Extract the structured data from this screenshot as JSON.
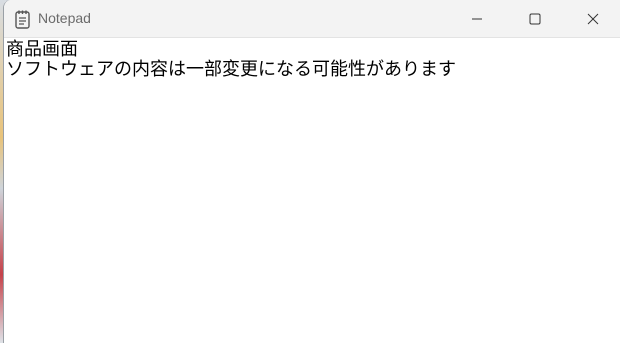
{
  "window": {
    "title": "Notepad",
    "controls": {
      "minimize_icon": "minimize-icon",
      "maximize_icon": "maximize-icon",
      "close_icon": "close-icon"
    }
  },
  "document": {
    "lines": [
      "商品画面",
      "ソフトウェアの内容は一部変更になる可能性があります"
    ]
  },
  "colors": {
    "titlebar": "#f3f3f3",
    "editor_background": "#ffffff",
    "text": "#000000",
    "title_text": "#6b6b6b"
  }
}
